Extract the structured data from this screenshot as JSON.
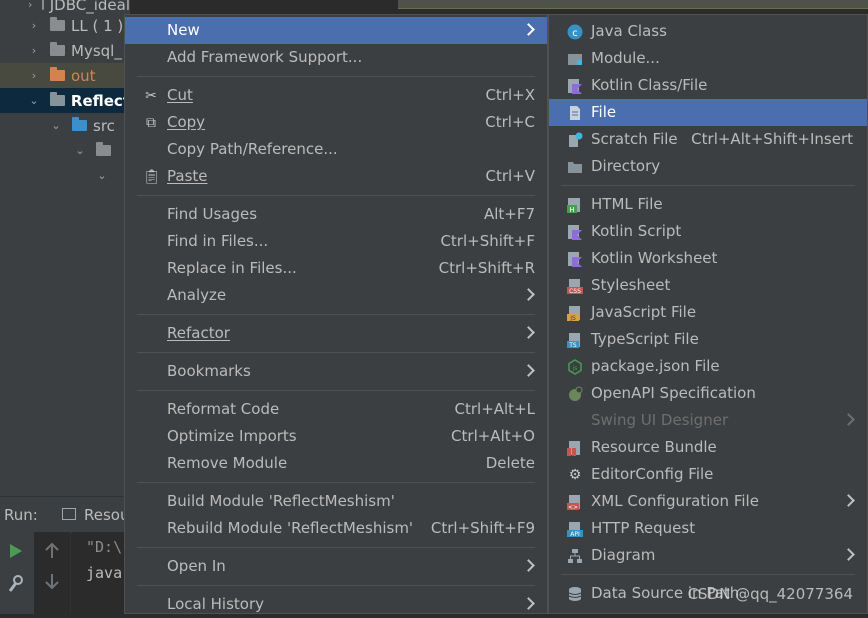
{
  "project_tree": {
    "items": [
      {
        "label": "JDBC_ideal",
        "arrow": "›"
      },
      {
        "label": "LL ( 1 )",
        "arrow": "›"
      },
      {
        "label": "Mysql_",
        "arrow": "›"
      },
      {
        "label": "out",
        "arrow": "›"
      },
      {
        "label": "Reflect",
        "arrow": "⌄"
      },
      {
        "label": "src",
        "arrow": "⌄"
      },
      {
        "label": "",
        "arrow": "⌄"
      },
      {
        "label": "",
        "arrow": "⌄"
      }
    ]
  },
  "run_panel": {
    "label": "Run:",
    "tab": "Resou",
    "console_lines": [
      "\"D:\\",
      "java"
    ]
  },
  "main_menu": {
    "new": "New",
    "add_framework": "Add Framework Support...",
    "cut": "Cut",
    "cut_sc": "Ctrl+X",
    "copy": "Copy",
    "copy_sc": "Ctrl+C",
    "copy_path": "Copy Path/Reference...",
    "paste": "Paste",
    "paste_sc": "Ctrl+V",
    "find_usages": "Find Usages",
    "find_usages_sc": "Alt+F7",
    "find_in_files": "Find in Files...",
    "find_in_files_sc": "Ctrl+Shift+F",
    "replace_in_files": "Replace in Files...",
    "replace_in_files_sc": "Ctrl+Shift+R",
    "analyze": "Analyze",
    "refactor": "Refactor",
    "bookmarks": "Bookmarks",
    "reformat": "Reformat Code",
    "reformat_sc": "Ctrl+Alt+L",
    "optimize": "Optimize Imports",
    "optimize_sc": "Ctrl+Alt+O",
    "remove_module": "Remove Module",
    "remove_module_sc": "Delete",
    "build_module": "Build Module 'ReflectMeshism'",
    "rebuild_module": "Rebuild Module 'ReflectMeshism'",
    "rebuild_module_sc": "Ctrl+Shift+F9",
    "open_in": "Open In",
    "local_history": "Local History"
  },
  "sub_menu": {
    "java_class": "Java Class",
    "module": "Module...",
    "kotlin_class": "Kotlin Class/File",
    "file": "File",
    "scratch_file": "Scratch File",
    "scratch_file_sc": "Ctrl+Alt+Shift+Insert",
    "directory": "Directory",
    "html_file": "HTML File",
    "kotlin_script": "Kotlin Script",
    "kotlin_worksheet": "Kotlin Worksheet",
    "stylesheet": "Stylesheet",
    "javascript_file": "JavaScript File",
    "typescript_file": "TypeScript File",
    "package_json": "package.json File",
    "openapi": "OpenAPI Specification",
    "swing_ui": "Swing UI Designer",
    "resource_bundle": "Resource Bundle",
    "editorconfig": "EditorConfig File",
    "xml_config": "XML Configuration File",
    "http_request": "HTTP Request",
    "diagram": "Diagram",
    "data_source": "Data Source in Path"
  },
  "watermark": "CSDN @qq_42077364",
  "colors": {
    "menu_bg": "#3c3f41",
    "highlight": "#4b6eaf",
    "text": "#bbbbbb"
  }
}
